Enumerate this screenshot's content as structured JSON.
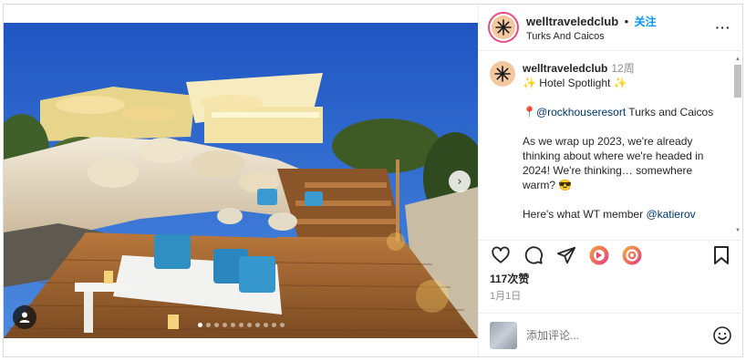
{
  "post": {
    "username": "welltraveledclub",
    "separator": "•",
    "follow_label": "关注",
    "location": "Turks And Caicos",
    "more_label": "···"
  },
  "caption": {
    "username": "welltraveledclub",
    "time": "12周",
    "line1": "✨ Hotel Spotlight ✨",
    "line2_pin": "📍",
    "line2_mention": "@rockhouseresort",
    "line2_rest": " Turks and Caicos",
    "para1": "As we wrap up 2023, we're already thinking about where we're headed in 2024! We're thinking… somewhere warm? 😎",
    "para2_text": "Here's what WT member ",
    "para2_mention": "@katierov"
  },
  "carousel": {
    "next_label": "›",
    "total": 11,
    "current": 1
  },
  "stats": {
    "likes": "117次赞",
    "date": "1月1日"
  },
  "comment": {
    "placeholder": "添加评论..."
  },
  "colors": {
    "accent": "#0095f6",
    "ring": "#e64b7f",
    "link": "#00376b"
  },
  "icons": [
    "heart-icon",
    "comment-icon",
    "share-icon",
    "reels-remix-icon",
    "threads-icon",
    "bookmark-icon",
    "emoji-icon",
    "user-tag-icon",
    "chevron-right-icon"
  ]
}
